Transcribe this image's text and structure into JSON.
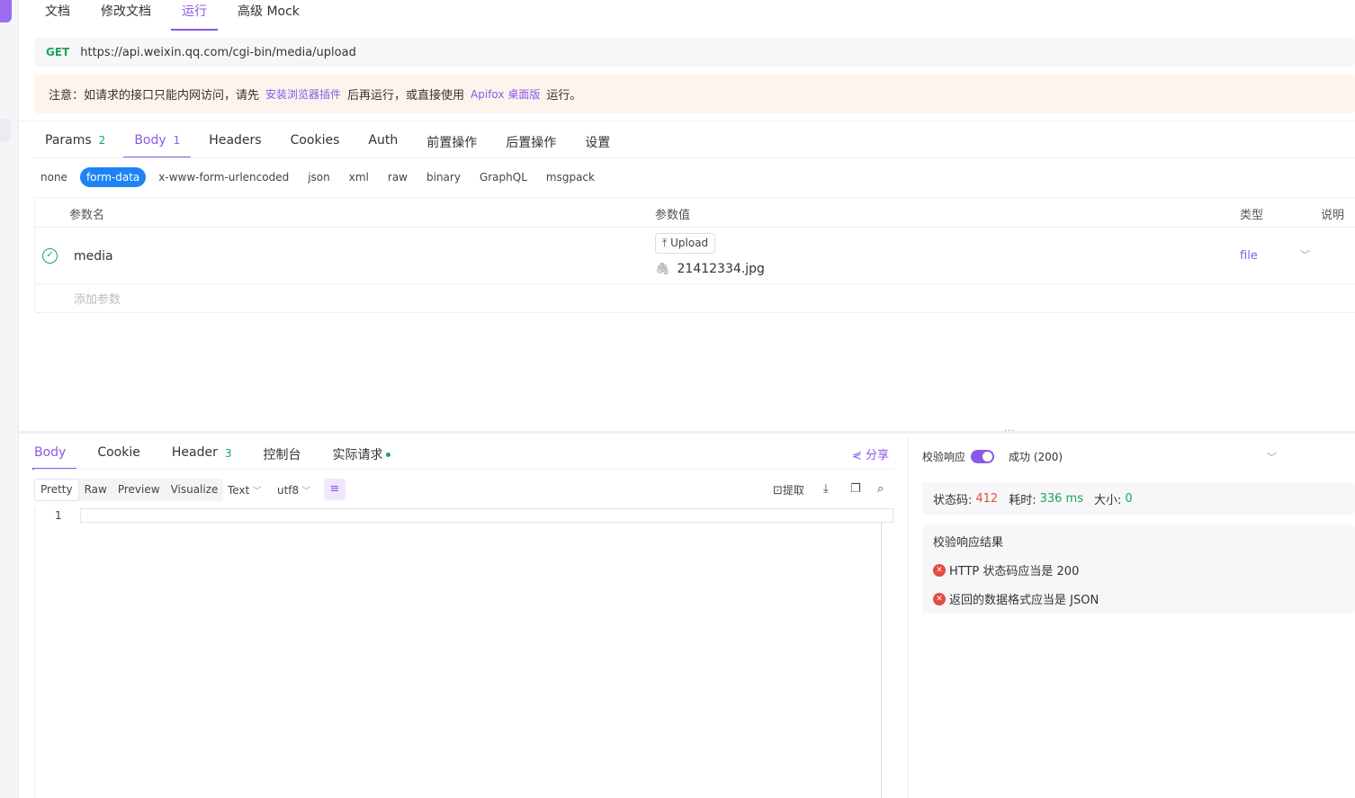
{
  "top_tabs": [
    "文档",
    "修改文档",
    "运行",
    "高级 Mock"
  ],
  "url_bar": {
    "method": "GET",
    "url": "https://api.weixin.qq.com/cgi-bin/media/upload"
  },
  "notice": {
    "prefix": "注意：如请求的接口只能内网访问，请先",
    "link1": "安装浏览器插件",
    "middle": "后再运行，或直接使用",
    "link2": "Apifox 桌面版",
    "suffix": "运行。"
  },
  "request_tabs": [
    {
      "label": "Params",
      "count": "2"
    },
    {
      "label": "Body",
      "count": "1"
    },
    {
      "label": "Headers",
      "count": ""
    },
    {
      "label": "Cookies",
      "count": ""
    },
    {
      "label": "Auth",
      "count": ""
    },
    {
      "label": "前置操作",
      "count": ""
    },
    {
      "label": "后置操作",
      "count": ""
    },
    {
      "label": "设置",
      "count": ""
    }
  ],
  "body_types": [
    "none",
    "form-data",
    "x-www-form-urlencoded",
    "json",
    "xml",
    "raw",
    "binary",
    "GraphQL",
    "msgpack"
  ],
  "param_table": {
    "headers": {
      "name": "参数名",
      "value": "参数值",
      "type": "类型",
      "desc": "说明"
    },
    "row": {
      "name": "media",
      "upload_label": "Upload",
      "file_name": "21412334.jpg",
      "type": "file"
    },
    "add_placeholder": "添加参数"
  },
  "response_tabs": [
    {
      "label": "Body",
      "count": ""
    },
    {
      "label": "Cookie",
      "count": ""
    },
    {
      "label": "Header",
      "count": "3"
    },
    {
      "label": "控制台",
      "count": ""
    },
    {
      "label": "实际请求",
      "count": ""
    }
  ],
  "share_label": "分享",
  "view_modes": [
    "Pretty",
    "Raw",
    "Preview",
    "Visualize"
  ],
  "format_select": "Text",
  "encoding_select": "utf8",
  "extract_label": "提取",
  "editor": {
    "line_number": "1"
  },
  "validation": {
    "label": "校验响应",
    "selected": "成功 (200)",
    "status_label": "状态码:",
    "status_value": "412",
    "time_label": "耗时:",
    "time_value": "336 ms",
    "size_label": "大小:",
    "size_value": "0",
    "result_title": "校验响应结果",
    "results": [
      "HTTP 状态码应当是 200",
      "返回的数据格式应当是 JSON"
    ]
  },
  "colors": {
    "accent": "#8a59e8",
    "success": "#1aa65a",
    "error": "#e64c3c",
    "form_data_pill": "#1f83f5"
  }
}
